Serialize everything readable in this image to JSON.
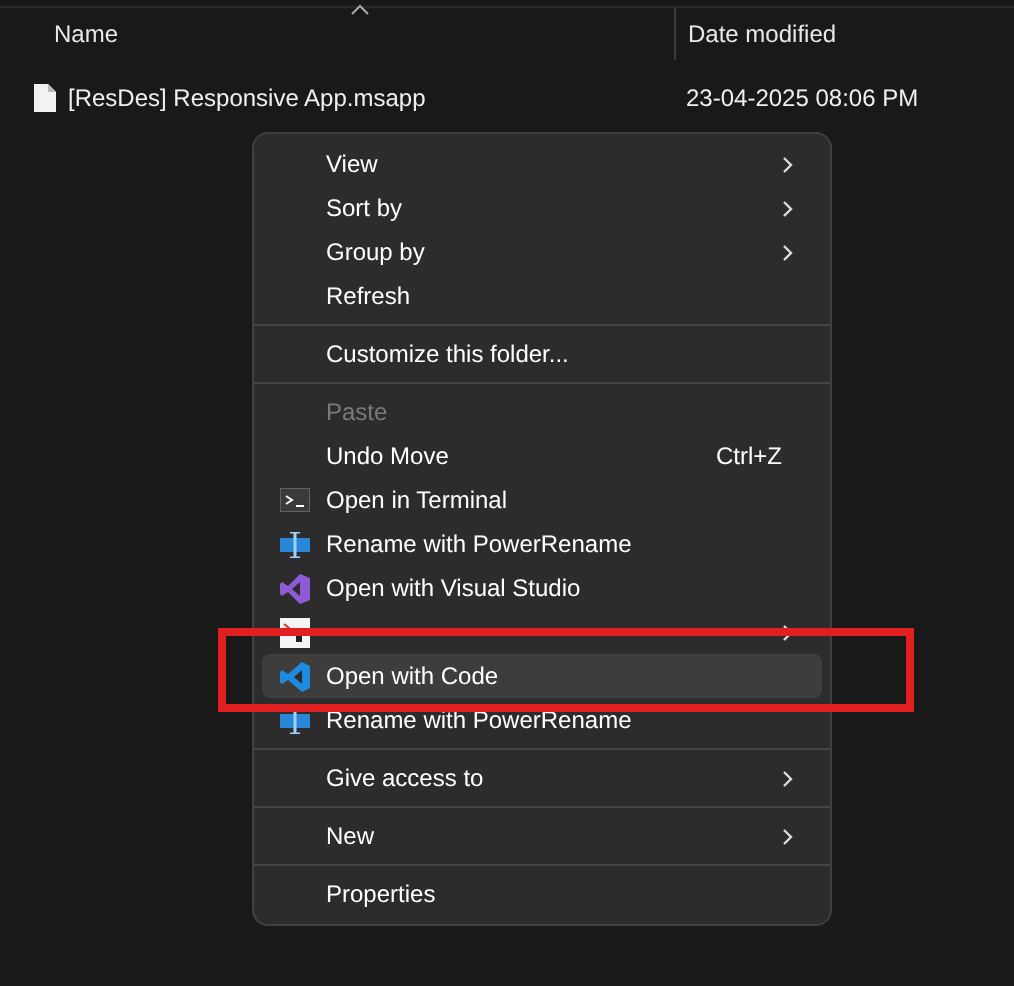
{
  "header": {
    "columns": [
      {
        "label": "Name",
        "sorted": true
      },
      {
        "label": "Date modified",
        "sorted": false
      }
    ]
  },
  "files": [
    {
      "name": "[ResDes] Responsive App.msapp",
      "date": "23-04-2025 08:06 PM"
    }
  ],
  "context_menu": {
    "items": [
      {
        "kind": "item",
        "label": "View",
        "submenu": true,
        "disabled": false,
        "selected": false
      },
      {
        "kind": "item",
        "label": "Sort by",
        "submenu": true,
        "disabled": false,
        "selected": false
      },
      {
        "kind": "item",
        "label": "Group by",
        "submenu": true,
        "disabled": false,
        "selected": false
      },
      {
        "kind": "item",
        "label": "Refresh",
        "submenu": false,
        "disabled": false,
        "selected": false
      },
      {
        "kind": "separator"
      },
      {
        "kind": "item",
        "label": "Customize this folder...",
        "submenu": false,
        "disabled": false,
        "selected": false
      },
      {
        "kind": "separator"
      },
      {
        "kind": "item",
        "label": "Paste",
        "submenu": false,
        "disabled": true,
        "selected": false
      },
      {
        "kind": "item",
        "label": "Undo Move",
        "shortcut": "Ctrl+Z",
        "submenu": false,
        "disabled": false,
        "selected": false
      },
      {
        "kind": "app",
        "label": "Open in Terminal",
        "submenu": false,
        "disabled": false,
        "selected": false
      },
      {
        "kind": "app",
        "label": "Rename with PowerRename",
        "submenu": false,
        "disabled": false,
        "selected": false
      },
      {
        "kind": "app",
        "label": "Open with Visual Studio",
        "submenu": false,
        "disabled": false,
        "selected": false
      },
      {
        "kind": "app",
        "submenu": true,
        "disabled": false,
        "selected": false
      },
      {
        "kind": "app",
        "label": "Open with Code",
        "submenu": false,
        "disabled": false,
        "selected": true
      },
      {
        "kind": "app",
        "label": "Rename with PowerRename",
        "submenu": false,
        "disabled": false,
        "selected": false
      },
      {
        "kind": "separator"
      },
      {
        "kind": "item",
        "label": "Give access to",
        "submenu": true,
        "disabled": false,
        "selected": false
      },
      {
        "kind": "separator"
      },
      {
        "kind": "item",
        "label": "New",
        "submenu": true,
        "disabled": false,
        "selected": false
      },
      {
        "kind": "separator"
      },
      {
        "kind": "item",
        "label": "Properties",
        "submenu": false,
        "disabled": false,
        "selected": false
      }
    ]
  },
  "annotation": {
    "kind": "rectangle"
  }
}
